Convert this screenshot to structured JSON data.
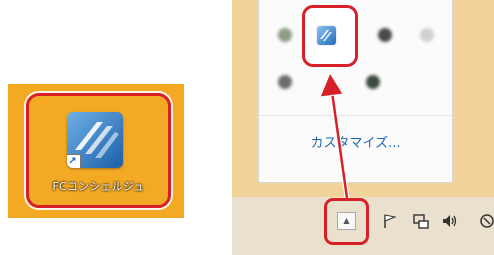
{
  "desktop": {
    "shortcut_label": "FCコンシェルジュ",
    "icon_name": "fc-concierge-app-icon"
  },
  "tray_popup": {
    "customize_label": "カスタマイズ..."
  },
  "taskbar": {
    "overflow_chevron_glyph": "▲"
  },
  "colors": {
    "desktop_bg": "#f3a923",
    "highlight_red": "#d91f28",
    "link_blue": "#1f66b7"
  }
}
